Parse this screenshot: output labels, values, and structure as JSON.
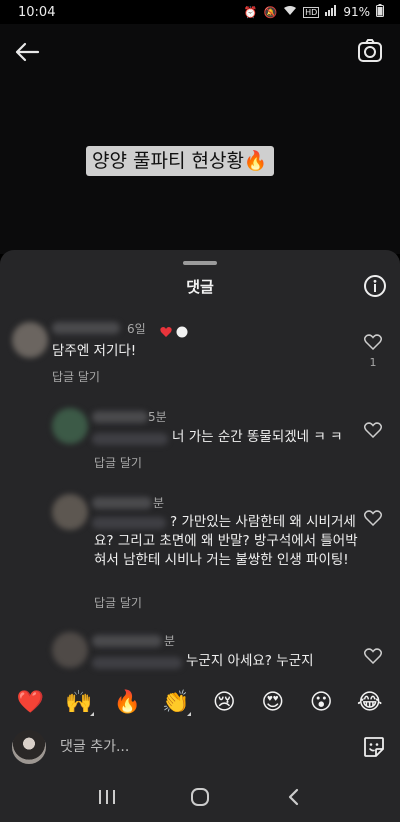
{
  "status_bar": {
    "time": "10:04",
    "battery": "91%",
    "icons": [
      "alarm-icon",
      "mute-icon",
      "wifi-icon",
      "hd-voice-icon",
      "signal-icon",
      "battery-icon"
    ]
  },
  "story": {
    "caption": "양양 풀파티 현상황🔥"
  },
  "sheet": {
    "title": "댓글"
  },
  "comments": [
    {
      "time": "6일",
      "text": "담주엔 저기다!",
      "reply_label": "답글 달기",
      "likes": "1"
    },
    {
      "time": "5분",
      "text": "너 가는 순간 똥물되겠네 ㅋ ㅋ",
      "reply_label": "답글 달기"
    },
    {
      "time": "분",
      "text": "? 가만있는 사람한테 왜 시비거세요? 그리고 초면에 왜 반말? 방구석에서 틀어박혀서 남한테 시비나 거는 불쌍한 인생 파이팅!",
      "reply_label": "답글 달기"
    },
    {
      "time": "분",
      "text": "누군지 아세요? 누군지"
    }
  ],
  "emoji_bar": [
    "❤️",
    "🙌",
    "🔥",
    "👏",
    "😢",
    "😍",
    "😮",
    "😂"
  ],
  "input": {
    "placeholder": "댓글 추가..."
  },
  "colors": {
    "sheet_bg": "#262628",
    "heart_red": "#e8343b",
    "secondary_text": "#a8a8a8"
  }
}
